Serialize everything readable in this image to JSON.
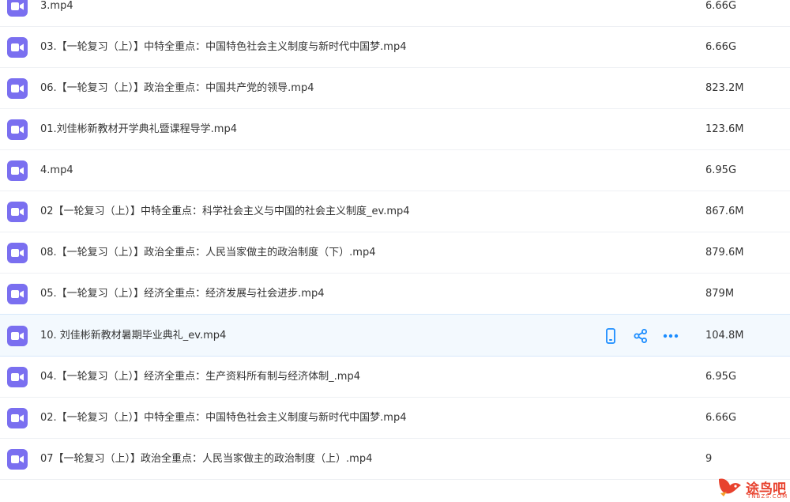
{
  "colors": {
    "file_icon": "#7a6ff0",
    "action_icon": "#1a8cff",
    "hover_row": "#f3f9fe",
    "divider": "#eef0f4",
    "watermark": "#e8422e"
  },
  "icons": {
    "file": "video-file-icon",
    "actions": [
      "phone-icon",
      "share-icon",
      "more-icon"
    ]
  },
  "files": [
    {
      "name": "3.mp4",
      "size": "6.66G"
    },
    {
      "name": "03.【一轮复习（上）】中特全重点：中国特色社会主义制度与新时代中国梦.mp4",
      "size": "6.66G"
    },
    {
      "name": "06.【一轮复习（上）】政治全重点：中国共产党的领导.mp4",
      "size": "823.2M"
    },
    {
      "name": "01.刘佳彬新教材开学典礼暨课程导学.mp4",
      "size": "123.6M"
    },
    {
      "name": "4.mp4",
      "size": "6.95G"
    },
    {
      "name": "02【一轮复习（上）】中特全重点：科学社会主义与中国的社会主义制度_ev.mp4",
      "size": "867.6M"
    },
    {
      "name": "08.【一轮复习（上）】政治全重点：人民当家做主的政治制度（下）.mp4",
      "size": "879.6M"
    },
    {
      "name": "05.【一轮复习（上）】经济全重点：经济发展与社会进步.mp4",
      "size": "879M"
    },
    {
      "name": "10. 刘佳彬新教材暑期毕业典礼_ev.mp4",
      "size": "104.8M",
      "hovered": true
    },
    {
      "name": "04.【一轮复习（上）】经济全重点：生产资料所有制与经济体制_.mp4",
      "size": "6.95G"
    },
    {
      "name": "02.【一轮复习（上）】中特全重点：中国特色社会主义制度与新时代中国梦.mp4",
      "size": "6.66G"
    },
    {
      "name": "07【一轮复习（上）】政治全重点：人民当家做主的政治制度（上）.mp4",
      "size": "9"
    }
  ],
  "watermark": {
    "text": "途鸟吧",
    "sub": "TNBZS.COM"
  }
}
